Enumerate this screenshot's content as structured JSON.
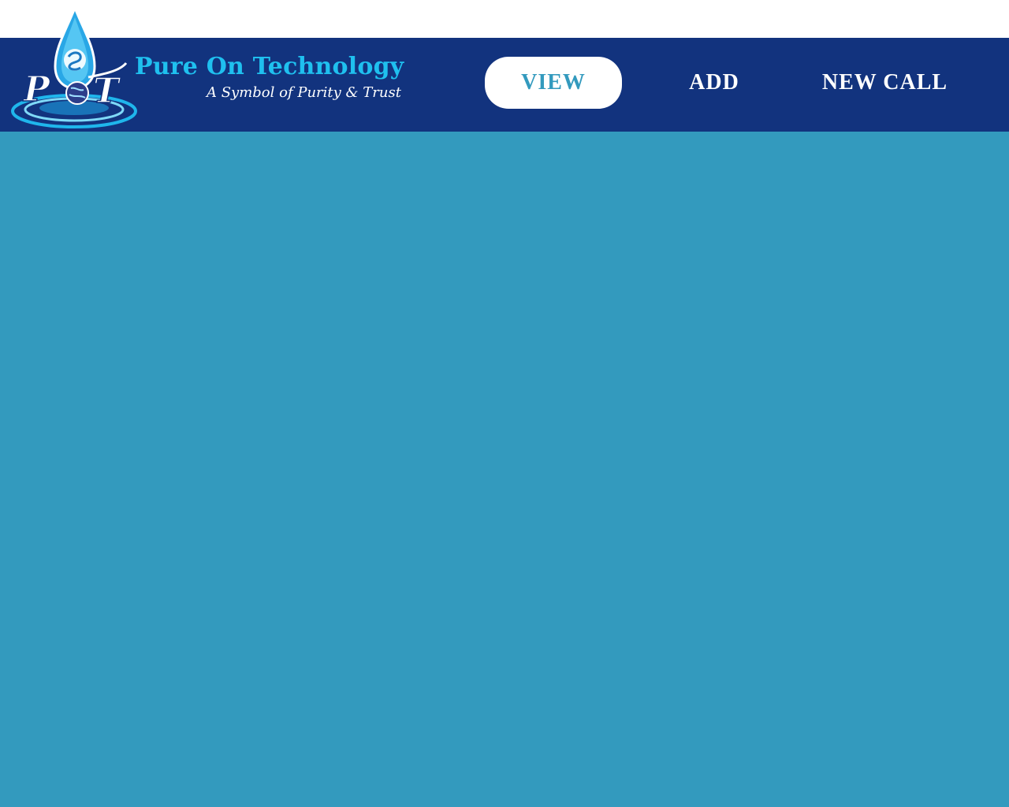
{
  "brand": {
    "name": "Pure On Technology",
    "tagline": "A Symbol of Purity & Trust",
    "logo_letters": "POT",
    "logo_icon": "water-drop-globe-logo"
  },
  "nav": {
    "view_label": "VIEW",
    "add_label": "ADD",
    "new_call_label": "NEW CALL",
    "active": "VIEW"
  },
  "colors": {
    "navbar_bg": "#12337e",
    "content_bg": "#339abe",
    "brand_text": "#1fc0ef",
    "active_tab_bg": "#ffffff",
    "active_tab_text": "#339abe",
    "tab_text": "#ffffff"
  }
}
